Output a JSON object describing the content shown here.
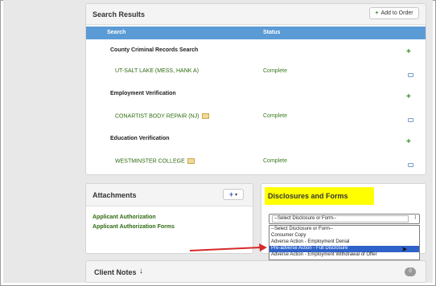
{
  "search_results": {
    "title": "Search Results",
    "add_button_label": "Add to Order",
    "columns": {
      "search": "Search",
      "status": "Status"
    },
    "groups": [
      {
        "name": "County Criminal Records Search",
        "item": "UT-SALT LAKE (MESS, HANK A)",
        "status": "Complete"
      },
      {
        "name": "Employment Verification",
        "item": "CONARTIST BODY REPAIR (NJ)",
        "status": "Complete"
      },
      {
        "name": "Education Verification",
        "item": "WESTMINSTER COLLEGE",
        "status": "Complete"
      }
    ]
  },
  "attachments": {
    "title": "Attachments",
    "add_button_label": "+",
    "items": [
      "Applicant Authorization",
      "Applicant Authorization Forms"
    ]
  },
  "disclosures": {
    "title": "Disclosures and Forms",
    "highlight_color": "#ffff00",
    "select_value": "--Select Disclosure or Form--",
    "options": [
      "--Select Disclosure or Form--",
      "Consumer Copy",
      "Adverse Action - Employment Denial",
      "Pre-adverse Action - Full Disclosure",
      "Adverse Action - Employment Withdrawal of Offer"
    ],
    "selected_index": 3
  },
  "client_notes": {
    "title": "Client Notes",
    "count": "0"
  },
  "annotation": {
    "arrow_color": "#d62a2a"
  }
}
